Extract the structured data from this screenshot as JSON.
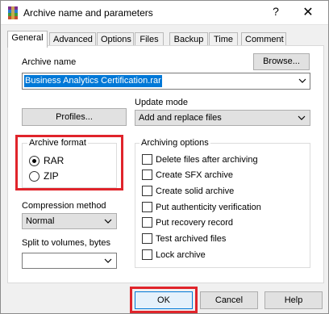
{
  "window": {
    "title": "Archive name and parameters",
    "help_glyph": "?",
    "close_glyph": "✕"
  },
  "tabs": [
    "General",
    "Advanced",
    "Options",
    "Files",
    "Backup",
    "Time",
    "Comment"
  ],
  "archive_name": {
    "label": "Archive name",
    "browse_label": "Browse...",
    "value": "Business Analytics Certification.rar"
  },
  "profiles_label": "Profiles...",
  "update_mode": {
    "label": "Update mode",
    "selected": "Add and replace files"
  },
  "archive_format": {
    "label": "Archive format",
    "options": [
      "RAR",
      "ZIP"
    ],
    "selected": "RAR"
  },
  "compression_method": {
    "label": "Compression method",
    "selected": "Normal"
  },
  "split_volumes": {
    "label": "Split to volumes, bytes",
    "value": ""
  },
  "archiving_options": {
    "label": "Archiving options",
    "items": [
      {
        "label": "Delete files after archiving",
        "checked": false
      },
      {
        "label": "Create SFX archive",
        "checked": false
      },
      {
        "label": "Create solid archive",
        "checked": false
      },
      {
        "label": "Put authenticity verification",
        "checked": false
      },
      {
        "label": "Put recovery record",
        "checked": false
      },
      {
        "label": "Test archived files",
        "checked": false
      },
      {
        "label": "Lock archive",
        "checked": false
      }
    ]
  },
  "buttons": {
    "ok": "OK",
    "cancel": "Cancel",
    "help": "Help"
  },
  "colors": {
    "highlight_red": "#e0242b",
    "selection_blue": "#0078d7"
  }
}
